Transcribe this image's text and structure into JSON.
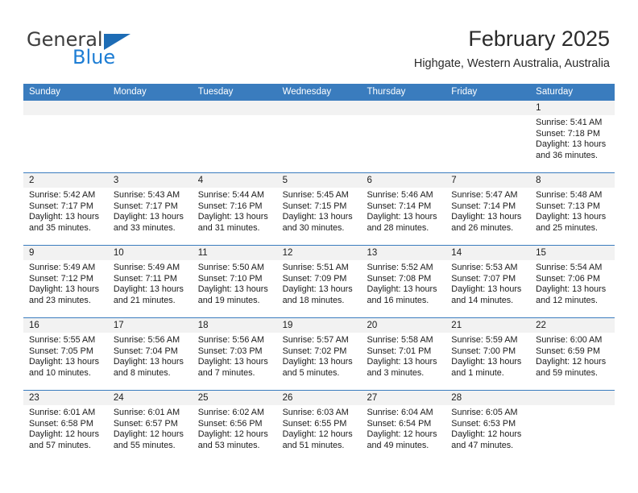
{
  "brand": {
    "name_top": "General",
    "name_bottom": "Blue",
    "triangle_color": "#1d6cb5",
    "blue_color": "#1d7dd4"
  },
  "header": {
    "title": "February 2025",
    "subtitle": "Highgate, Western Australia, Australia"
  },
  "theme": {
    "header_blue": "#3a7cbe",
    "date_strip_gray": "#f2f2f2",
    "text_dark": "#1b1b1b"
  },
  "weekdays": [
    "Sunday",
    "Monday",
    "Tuesday",
    "Wednesday",
    "Thursday",
    "Friday",
    "Saturday"
  ],
  "weeks": [
    {
      "days": [
        {
          "blank": true
        },
        {
          "blank": true
        },
        {
          "blank": true
        },
        {
          "blank": true
        },
        {
          "blank": true
        },
        {
          "blank": true
        },
        {
          "date": "1",
          "sunrise": "Sunrise: 5:41 AM",
          "sunset": "Sunset: 7:18 PM",
          "daylight": "Daylight: 13 hours and 36 minutes."
        }
      ]
    },
    {
      "days": [
        {
          "date": "2",
          "sunrise": "Sunrise: 5:42 AM",
          "sunset": "Sunset: 7:17 PM",
          "daylight": "Daylight: 13 hours and 35 minutes."
        },
        {
          "date": "3",
          "sunrise": "Sunrise: 5:43 AM",
          "sunset": "Sunset: 7:17 PM",
          "daylight": "Daylight: 13 hours and 33 minutes."
        },
        {
          "date": "4",
          "sunrise": "Sunrise: 5:44 AM",
          "sunset": "Sunset: 7:16 PM",
          "daylight": "Daylight: 13 hours and 31 minutes."
        },
        {
          "date": "5",
          "sunrise": "Sunrise: 5:45 AM",
          "sunset": "Sunset: 7:15 PM",
          "daylight": "Daylight: 13 hours and 30 minutes."
        },
        {
          "date": "6",
          "sunrise": "Sunrise: 5:46 AM",
          "sunset": "Sunset: 7:14 PM",
          "daylight": "Daylight: 13 hours and 28 minutes."
        },
        {
          "date": "7",
          "sunrise": "Sunrise: 5:47 AM",
          "sunset": "Sunset: 7:14 PM",
          "daylight": "Daylight: 13 hours and 26 minutes."
        },
        {
          "date": "8",
          "sunrise": "Sunrise: 5:48 AM",
          "sunset": "Sunset: 7:13 PM",
          "daylight": "Daylight: 13 hours and 25 minutes."
        }
      ]
    },
    {
      "days": [
        {
          "date": "9",
          "sunrise": "Sunrise: 5:49 AM",
          "sunset": "Sunset: 7:12 PM",
          "daylight": "Daylight: 13 hours and 23 minutes."
        },
        {
          "date": "10",
          "sunrise": "Sunrise: 5:49 AM",
          "sunset": "Sunset: 7:11 PM",
          "daylight": "Daylight: 13 hours and 21 minutes."
        },
        {
          "date": "11",
          "sunrise": "Sunrise: 5:50 AM",
          "sunset": "Sunset: 7:10 PM",
          "daylight": "Daylight: 13 hours and 19 minutes."
        },
        {
          "date": "12",
          "sunrise": "Sunrise: 5:51 AM",
          "sunset": "Sunset: 7:09 PM",
          "daylight": "Daylight: 13 hours and 18 minutes."
        },
        {
          "date": "13",
          "sunrise": "Sunrise: 5:52 AM",
          "sunset": "Sunset: 7:08 PM",
          "daylight": "Daylight: 13 hours and 16 minutes."
        },
        {
          "date": "14",
          "sunrise": "Sunrise: 5:53 AM",
          "sunset": "Sunset: 7:07 PM",
          "daylight": "Daylight: 13 hours and 14 minutes."
        },
        {
          "date": "15",
          "sunrise": "Sunrise: 5:54 AM",
          "sunset": "Sunset: 7:06 PM",
          "daylight": "Daylight: 13 hours and 12 minutes."
        }
      ]
    },
    {
      "days": [
        {
          "date": "16",
          "sunrise": "Sunrise: 5:55 AM",
          "sunset": "Sunset: 7:05 PM",
          "daylight": "Daylight: 13 hours and 10 minutes."
        },
        {
          "date": "17",
          "sunrise": "Sunrise: 5:56 AM",
          "sunset": "Sunset: 7:04 PM",
          "daylight": "Daylight: 13 hours and 8 minutes."
        },
        {
          "date": "18",
          "sunrise": "Sunrise: 5:56 AM",
          "sunset": "Sunset: 7:03 PM",
          "daylight": "Daylight: 13 hours and 7 minutes."
        },
        {
          "date": "19",
          "sunrise": "Sunrise: 5:57 AM",
          "sunset": "Sunset: 7:02 PM",
          "daylight": "Daylight: 13 hours and 5 minutes."
        },
        {
          "date": "20",
          "sunrise": "Sunrise: 5:58 AM",
          "sunset": "Sunset: 7:01 PM",
          "daylight": "Daylight: 13 hours and 3 minutes."
        },
        {
          "date": "21",
          "sunrise": "Sunrise: 5:59 AM",
          "sunset": "Sunset: 7:00 PM",
          "daylight": "Daylight: 13 hours and 1 minute."
        },
        {
          "date": "22",
          "sunrise": "Sunrise: 6:00 AM",
          "sunset": "Sunset: 6:59 PM",
          "daylight": "Daylight: 12 hours and 59 minutes."
        }
      ]
    },
    {
      "days": [
        {
          "date": "23",
          "sunrise": "Sunrise: 6:01 AM",
          "sunset": "Sunset: 6:58 PM",
          "daylight": "Daylight: 12 hours and 57 minutes."
        },
        {
          "date": "24",
          "sunrise": "Sunrise: 6:01 AM",
          "sunset": "Sunset: 6:57 PM",
          "daylight": "Daylight: 12 hours and 55 minutes."
        },
        {
          "date": "25",
          "sunrise": "Sunrise: 6:02 AM",
          "sunset": "Sunset: 6:56 PM",
          "daylight": "Daylight: 12 hours and 53 minutes."
        },
        {
          "date": "26",
          "sunrise": "Sunrise: 6:03 AM",
          "sunset": "Sunset: 6:55 PM",
          "daylight": "Daylight: 12 hours and 51 minutes."
        },
        {
          "date": "27",
          "sunrise": "Sunrise: 6:04 AM",
          "sunset": "Sunset: 6:54 PM",
          "daylight": "Daylight: 12 hours and 49 minutes."
        },
        {
          "date": "28",
          "sunrise": "Sunrise: 6:05 AM",
          "sunset": "Sunset: 6:53 PM",
          "daylight": "Daylight: 12 hours and 47 minutes."
        },
        {
          "blank": true
        }
      ]
    }
  ]
}
